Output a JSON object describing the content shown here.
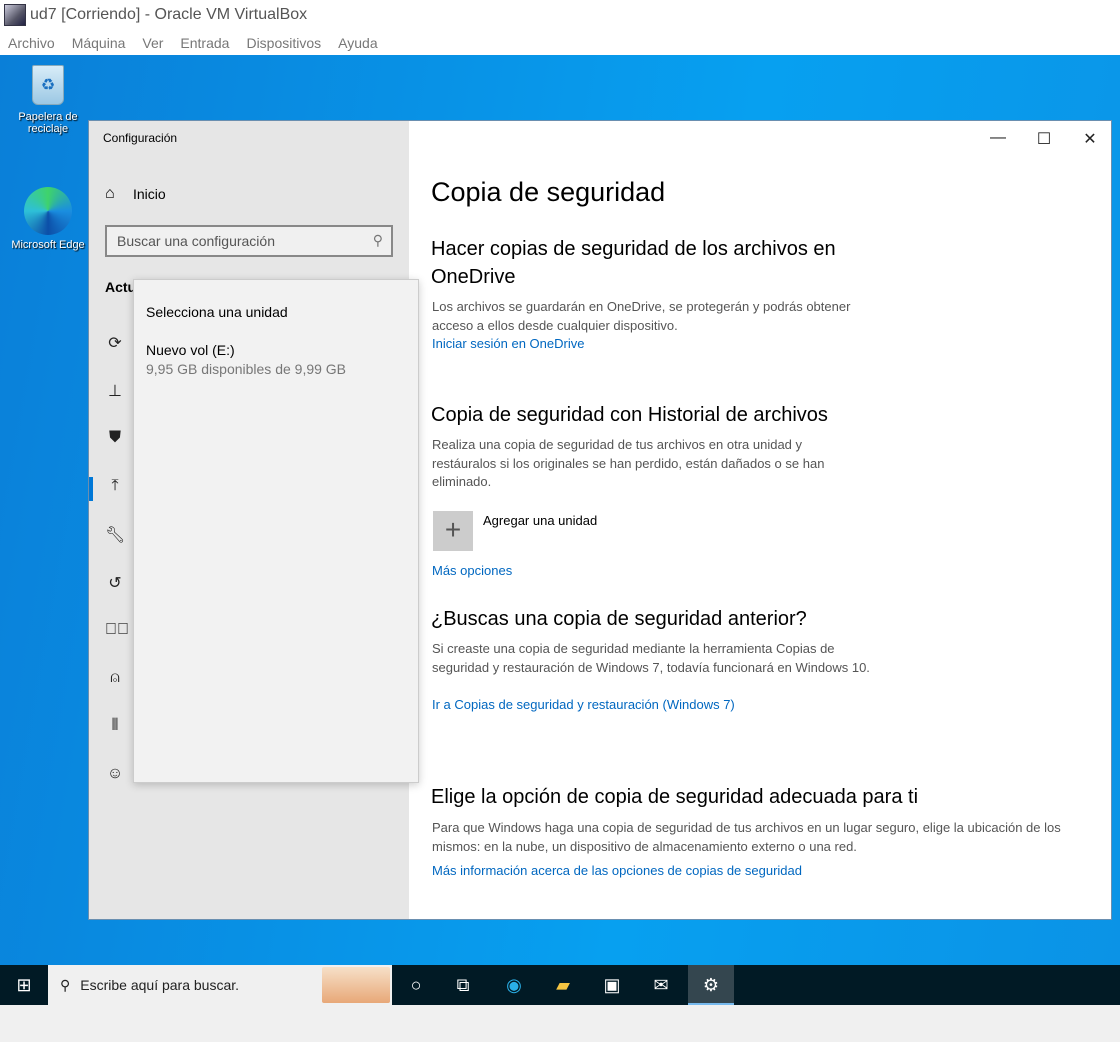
{
  "vbox": {
    "title": "ud7 [Corriendo] - Oracle VM VirtualBox",
    "menu": [
      "Archivo",
      "Máquina",
      "Ver",
      "Entrada",
      "Dispositivos",
      "Ayuda"
    ]
  },
  "desktop": {
    "icons": [
      {
        "label": "Papelera de reciclaje",
        "icon": "recycle-bin-icon"
      },
      {
        "label": "Microsoft Edge",
        "icon": "edge-icon"
      }
    ]
  },
  "window": {
    "title": "Configuración",
    "sidebar": {
      "home": "Inicio",
      "search_placeholder": "Buscar una configuración",
      "section": "Actu",
      "icons": [
        "sync-icon",
        "delivery-icon",
        "shield-icon",
        "backup-icon",
        "wrench-icon",
        "recovery-icon",
        "activation-icon",
        "find-device-icon",
        "developer-icon",
        "insider-icon"
      ]
    },
    "flyout": {
      "heading": "Selecciona una unidad",
      "drive_name": "Nuevo vol (E:)",
      "drive_space": "9,95 GB disponibles de 9,99 GB"
    },
    "main": {
      "title": "Copia de seguridad",
      "onedrive": {
        "heading": "Hacer copias de seguridad de los archivos en OneDrive",
        "text": "Los archivos se guardarán en OneDrive, se protegerán y podrás obtener acceso a ellos desde cualquier dispositivo.",
        "link": "Iniciar sesión en OneDrive"
      },
      "history": {
        "heading": "Copia de seguridad con Historial de archivos",
        "text": "Realiza una copia de seguridad de tus archivos en otra unidad y restáuralos si los originales se han perdido, están dañados o se han eliminado.",
        "add": "Agregar una unidad",
        "link": "Más opciones"
      },
      "older": {
        "heading": "¿Buscas una copia de seguridad anterior?",
        "text": "Si creaste una copia de seguridad mediante la herramienta Copias de seguridad y restauración de Windows 7, todavía funcionará en Windows 10.",
        "link": "Ir a Copias de seguridad y restauración (Windows 7)"
      },
      "choose": {
        "heading": "Elige la opción de copia de seguridad adecuada para ti",
        "text": "Para que Windows haga una copia de seguridad de tus archivos en un lugar seguro, elige la ubicación de los mismos: en la nube, un dispositivo de almacenamiento externo o una red.",
        "link": "Más información acerca de las opciones de copias de seguridad"
      }
    }
  },
  "taskbar": {
    "search_placeholder": "Escribe aquí para buscar.",
    "icons": [
      "cortana-icon",
      "task-view-icon",
      "edge-icon",
      "file-explorer-icon",
      "store-icon",
      "mail-icon",
      "settings-icon"
    ]
  },
  "colors": {
    "accent": "#0078d7",
    "link": "#0067c0"
  }
}
